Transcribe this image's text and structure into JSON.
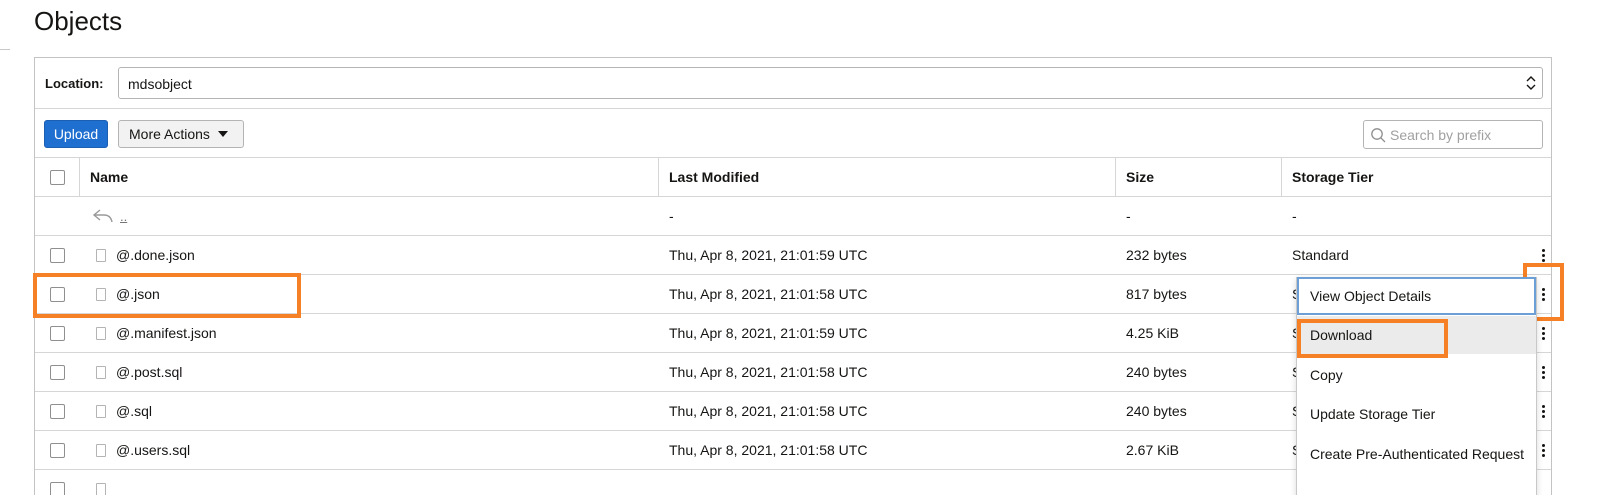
{
  "page": {
    "title": "Objects"
  },
  "location": {
    "label": "Location:",
    "value": "mdsobject"
  },
  "toolbar": {
    "upload_label": "Upload",
    "more_actions_label": "More Actions",
    "search_placeholder": "Search by prefix"
  },
  "table": {
    "columns": [
      "Name",
      "Last Modified",
      "Size",
      "Storage Tier"
    ],
    "parent_row": {
      "name": "..",
      "last_modified": "-",
      "size": "-",
      "storage_tier": "-"
    },
    "rows": [
      {
        "name": "@.done.json",
        "last_modified": "Thu, Apr 8, 2021, 21:01:59 UTC",
        "size": "232 bytes",
        "storage_tier": "Standard"
      },
      {
        "name": "@.json",
        "last_modified": "Thu, Apr 8, 2021, 21:01:58 UTC",
        "size": "817 bytes",
        "storage_tier": "S"
      },
      {
        "name": "@.manifest.json",
        "last_modified": "Thu, Apr 8, 2021, 21:01:59 UTC",
        "size": "4.25 KiB",
        "storage_tier": "S"
      },
      {
        "name": "@.post.sql",
        "last_modified": "Thu, Apr 8, 2021, 21:01:58 UTC",
        "size": "240 bytes",
        "storage_tier": "S"
      },
      {
        "name": "@.sql",
        "last_modified": "Thu, Apr 8, 2021, 21:01:58 UTC",
        "size": "240 bytes",
        "storage_tier": "S"
      },
      {
        "name": "@.users.sql",
        "last_modified": "Thu, Apr 8, 2021, 21:01:58 UTC",
        "size": "2.67 KiB",
        "storage_tier": "S"
      }
    ]
  },
  "context_menu": {
    "items": [
      "View Object Details",
      "Download",
      "Copy",
      "Update Storage Tier",
      "Create Pre-Authenticated Request"
    ]
  },
  "colors": {
    "accent": "#1f6fd1",
    "highlight": "#f58025",
    "focus_ring": "#6b9fd6"
  }
}
